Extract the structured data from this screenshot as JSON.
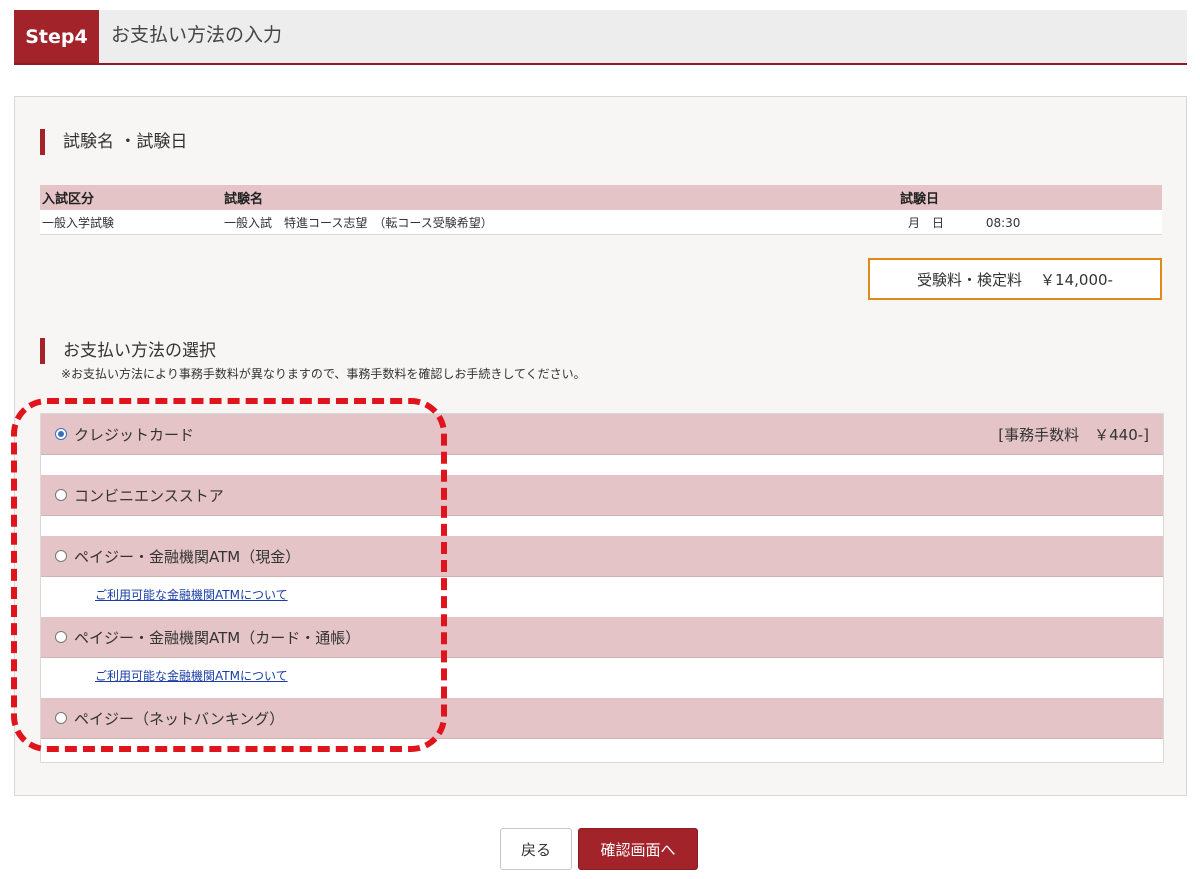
{
  "header": {
    "step_label": "Step4",
    "title": "お支払い方法の入力"
  },
  "exam_section": {
    "title": "試験名 ・試験日",
    "columns": [
      "入試区分",
      "試験名",
      "試験日"
    ],
    "rows": [
      {
        "category": "一般入学試験",
        "name": "一般入試　特進コース志望　（転コース受験希望）",
        "date": "月　日",
        "time": "08:30"
      }
    ]
  },
  "fee": {
    "label": "受験料・検定料",
    "amount": "￥14,000-"
  },
  "payment_section": {
    "title": "お支払い方法の選択",
    "note": "※お支払い方法により事務手数料が異なりますので、事務手数料を確認しお手続きしてください。",
    "options": [
      {
        "label": "クレジットカード",
        "fee": "[事務手数料　￥440-]",
        "selected": true
      },
      {
        "label": "コンビニエンスストア",
        "fee": "",
        "selected": false
      },
      {
        "label": "ペイジー・金融機関ATM（現金）",
        "fee": "",
        "selected": false,
        "link": "ご利用可能な金融機関ATMについて"
      },
      {
        "label": "ペイジー・金融機関ATM（カード・通帳）",
        "fee": "",
        "selected": false,
        "link": "ご利用可能な金融機関ATMについて"
      },
      {
        "label": "ペイジー（ネットバンキング）",
        "fee": "",
        "selected": false
      }
    ]
  },
  "buttons": {
    "back": "戻る",
    "confirm": "確認画面へ"
  },
  "colors": {
    "brand": "#a3232b",
    "row_bg": "#e5c4c7",
    "highlight": "#e0141c",
    "fee_border": "#e08a1a"
  }
}
